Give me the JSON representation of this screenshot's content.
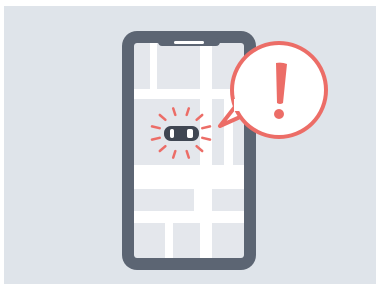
{
  "illustration": {
    "theme": "phone-map-car-alert",
    "icons": [
      "smartphone-icon",
      "map-icon",
      "car-icon",
      "alert-bubble-icon",
      "exclamation-icon"
    ]
  },
  "colors": {
    "frame_background": "#dfe4ea",
    "phone_body": "#5c6573",
    "map_background": "#e4e7ec",
    "map_roads": "#ffffff",
    "alert_accent": "#ec6d67",
    "bubble_fill": "#ffffff",
    "car_body": "#3f4652"
  }
}
